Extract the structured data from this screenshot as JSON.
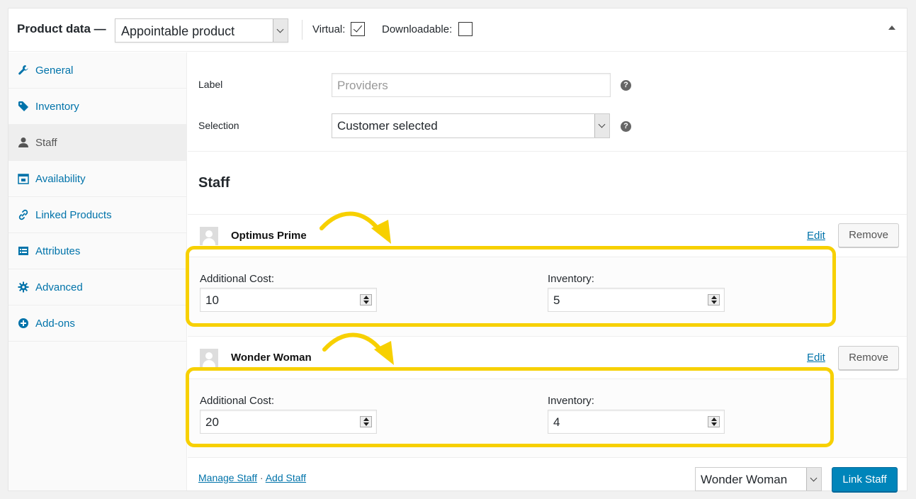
{
  "header": {
    "title": "Product data —",
    "product_type": "Appointable product",
    "virtual_label": "Virtual:",
    "virtual_checked": true,
    "downloadable_label": "Downloadable:",
    "downloadable_checked": false
  },
  "sidebar": {
    "items": [
      {
        "label": "General",
        "icon": "wrench-icon"
      },
      {
        "label": "Inventory",
        "icon": "tag-icon"
      },
      {
        "label": "Staff",
        "icon": "person-icon",
        "active": true
      },
      {
        "label": "Availability",
        "icon": "calendar-icon"
      },
      {
        "label": "Linked Products",
        "icon": "link-icon"
      },
      {
        "label": "Attributes",
        "icon": "list-icon"
      },
      {
        "label": "Advanced",
        "icon": "gear-icon"
      },
      {
        "label": "Add-ons",
        "icon": "plus-circle-icon"
      }
    ]
  },
  "form": {
    "label_field": {
      "label": "Label",
      "placeholder": "Providers"
    },
    "selection_field": {
      "label": "Selection",
      "value": "Customer selected"
    },
    "help_glyph": "?"
  },
  "staff": {
    "heading": "Staff",
    "members": [
      {
        "name": "Optimus Prime",
        "edit": "Edit",
        "remove": "Remove",
        "cost_label": "Additional Cost:",
        "cost": "10",
        "inventory_label": "Inventory:",
        "inventory": "5"
      },
      {
        "name": "Wonder Woman",
        "edit": "Edit",
        "remove": "Remove",
        "cost_label": "Additional Cost:",
        "cost": "20",
        "inventory_label": "Inventory:",
        "inventory": "4"
      }
    ]
  },
  "footer": {
    "manage_staff": "Manage Staff",
    "separator": "·",
    "add_staff": "Add Staff",
    "selected_staff": "Wonder Woman",
    "link_button": "Link Staff"
  },
  "colors": {
    "accent": "#0073aa",
    "primary_button": "#0085ba",
    "highlight": "#f7d000"
  }
}
